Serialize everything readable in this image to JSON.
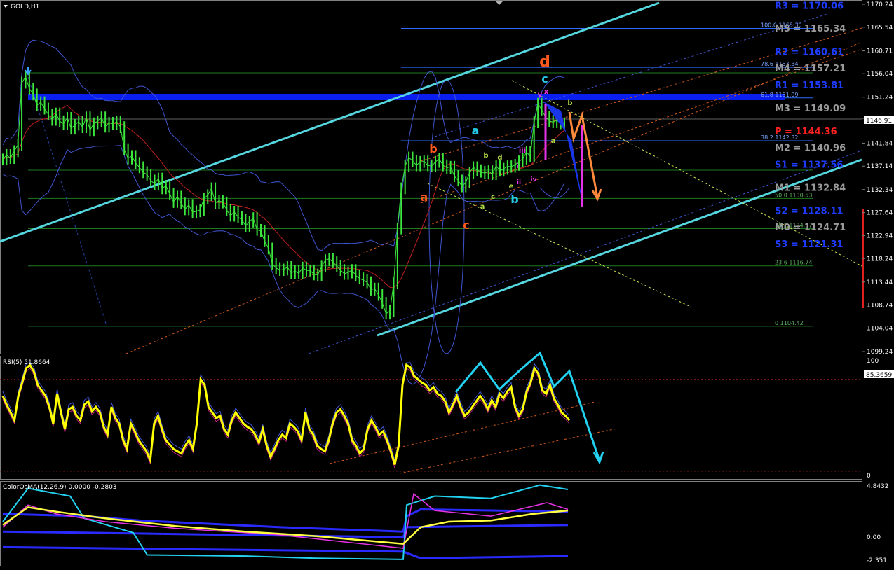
{
  "window": {
    "symbol_label": "GOLD,H1",
    "menu_icon": "triangle-down-icon"
  },
  "chart_data": [
    {
      "type": "line",
      "panel": "price",
      "symbol": "GOLD",
      "timeframe": "H1",
      "ylim": [
        1099.24,
        1170.24
      ],
      "y_ticks": [
        1170.24,
        1165.54,
        1160.71,
        1156.04,
        1151.24,
        1146.91,
        1141.84,
        1137.14,
        1132.34,
        1127.64,
        1122.94,
        1118.24,
        1113.44,
        1108.74,
        1104.04,
        1099.24
      ],
      "current_price": "1146.91",
      "price": [
        1138.5,
        1139.4,
        1138.8,
        1140.2,
        1141.5,
        1154.2,
        1155.4,
        1153.0,
        1151.8,
        1149.6,
        1150.2,
        1148.9,
        1147.7,
        1146.6,
        1147.9,
        1146.3,
        1145.8,
        1147.0,
        1144.8,
        1145.6,
        1146.2,
        1145.1,
        1147.1,
        1144.5,
        1145.9,
        1146.3,
        1147.1,
        1145.2,
        1146.0,
        1145.8,
        1146.2,
        1145.1,
        1140.6,
        1138.7,
        1139.2,
        1137.8,
        1136.9,
        1135.9,
        1135.4,
        1134.2,
        1133.5,
        1134.6,
        1132.6,
        1133.1,
        1131.5,
        1129.8,
        1130.9,
        1129.5,
        1128.3,
        1129.2,
        1127.7,
        1127.9,
        1128.2,
        1130.5,
        1131.2,
        1132.6,
        1129.6,
        1130.1,
        1129.7,
        1128.2,
        1127.0,
        1127.8,
        1126.7,
        1126.2,
        1124.9,
        1125.8,
        1126.5,
        1124.1,
        1123.9,
        1121.8,
        1120.3,
        1117.2,
        1116.3,
        1115.9,
        1116.0,
        1116.5,
        1115.3,
        1115.7,
        1115.2,
        1116.4,
        1115.8,
        1115.8,
        1115.0,
        1114.9,
        1116.6,
        1117.9,
        1118.2,
        1117.5,
        1116.7,
        1115.9,
        1115.1,
        1115.4,
        1115.9,
        1114.8,
        1114.2,
        1113.8,
        1113.4,
        1111.9,
        1112.1,
        1110.8,
        1109.2,
        1107.0,
        1107.5,
        1113.2,
        1124.4,
        1132.6,
        1137.1,
        1138.9,
        1138.2,
        1137.3,
        1138.0,
        1138.1,
        1137.3,
        1137.1,
        1138.0,
        1138.6,
        1137.3,
        1136.8,
        1137.0,
        1135.1,
        1134.2,
        1133.0,
        1133.8,
        1135.8,
        1136.9,
        1136.3,
        1136.0,
        1135.7,
        1136.1,
        1135.5,
        1137.2,
        1136.2,
        1136.6,
        1137.1,
        1137.0,
        1137.4,
        1138.1,
        1138.6,
        1140.0,
        1139.1,
        1146.1,
        1149.9,
        1148.7,
        1147.2,
        1146.4,
        1146.1,
        1146.5,
        1145.9,
        1145.7
      ],
      "pivot_levels": [
        {
          "label": "R3 = 1170.06",
          "value": 1170.06,
          "color": "#1e3cff"
        },
        {
          "label": "M5 = 1165.34",
          "value": 1165.34,
          "color": "#9a9a9a"
        },
        {
          "label": "R2 = 1160.61",
          "value": 1160.61,
          "color": "#1e3cff"
        },
        {
          "label": "M4 = 1157.21",
          "value": 1157.21,
          "color": "#9a9a9a"
        },
        {
          "label": "R1 = 1153.81",
          "value": 1153.81,
          "color": "#1e3cff"
        },
        {
          "label": "M3 = 1149.09",
          "value": 1149.09,
          "color": "#9a9a9a"
        },
        {
          "label": "P   = 1144.36",
          "value": 1144.36,
          "color": "#ff2020"
        },
        {
          "label": "M2 = 1140.96",
          "value": 1140.96,
          "color": "#9a9a9a"
        },
        {
          "label": "S1 = 1137.56",
          "value": 1137.56,
          "color": "#1e3cff"
        },
        {
          "label": "M1 = 1132.84",
          "value": 1132.84,
          "color": "#9a9a9a"
        },
        {
          "label": "S2 = 1128.11",
          "value": 1128.11,
          "color": "#1e3cff"
        },
        {
          "label": "M0 = 1124.71",
          "value": 1124.71,
          "color": "#9a9a9a"
        },
        {
          "label": "S3 = 1121.31",
          "value": 1121.31,
          "color": "#1e3cff"
        }
      ],
      "fib_levels": [
        {
          "label": "100.0  1165.30",
          "value": 1165.3,
          "color": "#2f6bff"
        },
        {
          "label": "78.6  1157.34",
          "value": 1157.34,
          "color": "#2f6bff"
        },
        {
          "label": "61.8  1151.09",
          "value": 1151.09,
          "color": "#2f6bff"
        },
        {
          "label": "38.2  1142.32",
          "value": 1142.32,
          "color": "#2f6bff"
        },
        {
          "label": "50.0  1130.53",
          "value": 1130.53,
          "color": "#1e7a1e"
        },
        {
          "label": "38.2  1124.37",
          "value": 1124.37,
          "color": "#1e7a1e"
        },
        {
          "label": "23.6  1116.74",
          "value": 1116.74,
          "color": "#1e7a1e"
        },
        {
          "label": "0  1104.42",
          "value": 1104.42,
          "color": "#1e7a1e"
        }
      ],
      "wave_labels": [
        {
          "text": "d",
          "color": "#ff5a1e"
        },
        {
          "text": "c",
          "color": "#23c8e6"
        },
        {
          "text": "a",
          "color": "#23c8e6"
        },
        {
          "text": "b",
          "color": "#ff5a1e"
        },
        {
          "text": "a",
          "color": "#ff5a1e"
        },
        {
          "text": "c",
          "color": "#ff5a1e"
        },
        {
          "text": "b",
          "color": "#23c8e6"
        },
        {
          "text": "a",
          "color": "#b4dc46"
        },
        {
          "text": "b",
          "color": "#b4dc46"
        },
        {
          "text": "c",
          "color": "#b4dc46"
        },
        {
          "text": "d",
          "color": "#b4dc46"
        },
        {
          "text": "e",
          "color": "#b4dc46"
        },
        {
          "text": "b",
          "color": "#b4dc46"
        },
        {
          "text": "a",
          "color": "#b4dc46"
        },
        {
          "text": "i",
          "color": "#e633e6"
        },
        {
          "text": "ii",
          "color": "#e633e6"
        },
        {
          "text": "iii",
          "color": "#e633e6"
        },
        {
          "text": "iv",
          "color": "#e633e6"
        },
        {
          "text": "v",
          "color": "#e633e6"
        },
        {
          "text": "x",
          "color": "#e633e6"
        }
      ]
    },
    {
      "type": "line",
      "panel": "rsi",
      "indicator_label": "RSI(5) 51.8664",
      "ylim": [
        0,
        100
      ],
      "y_ticks": [
        "100",
        "0"
      ],
      "level_label": "85.3659",
      "rsi": [
        70,
        62,
        55,
        48,
        70,
        82,
        95,
        98,
        92,
        80,
        75,
        70,
        60,
        45,
        72,
        55,
        40,
        58,
        60,
        52,
        48,
        62,
        65,
        56,
        60,
        55,
        42,
        35,
        60,
        50,
        45,
        30,
        22,
        45,
        38,
        30,
        25,
        20,
        12,
        45,
        52,
        40,
        30,
        26,
        22,
        20,
        18,
        25,
        30,
        22,
        45,
        85,
        80,
        60,
        55,
        50,
        52,
        40,
        35,
        48,
        55,
        50,
        45,
        42,
        40,
        35,
        28,
        40,
        25,
        15,
        22,
        30,
        35,
        32,
        45,
        42,
        38,
        30,
        55,
        40,
        35,
        25,
        22,
        20,
        30,
        45,
        55,
        58,
        52,
        45,
        30,
        25,
        18,
        22,
        40,
        48,
        42,
        35,
        38,
        30,
        20,
        8,
        25,
        80,
        98,
        96,
        88,
        85,
        82,
        80,
        75,
        78,
        72,
        70,
        65,
        55,
        62,
        70,
        60,
        52,
        55,
        60,
        65,
        70,
        65,
        58,
        66,
        60,
        72,
        68,
        74,
        78,
        60,
        52,
        58,
        74,
        82,
        95,
        90,
        75,
        72,
        80,
        68,
        62,
        55,
        52,
        48
      ],
      "arrow_color": "#23d2f0"
    },
    {
      "type": "line",
      "panel": "osma",
      "indicator_label": "ColorOsMA(12,26,9) 0.0000 -0.2803",
      "ylim": [
        -2.351,
        4.8432
      ],
      "y_ticks": [
        "4.8432",
        "0.00",
        "-2.351"
      ]
    }
  ]
}
